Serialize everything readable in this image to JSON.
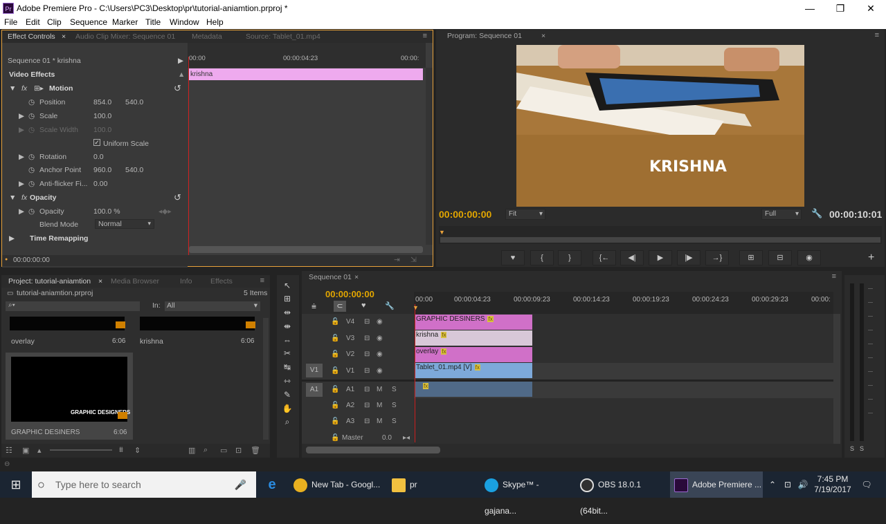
{
  "window": {
    "app_icon": "Pr",
    "title": "Adobe Premiere Pro - C:\\Users\\PC3\\Desktop\\pr\\tutorial-aniamtion.prproj *",
    "minimize": "—",
    "restore": "❐",
    "close": "✕"
  },
  "menu": [
    "File",
    "Edit",
    "Clip",
    "Sequence",
    "Marker",
    "Title",
    "Window",
    "Help"
  ],
  "effect_panel": {
    "tabs": [
      "Effect Controls",
      "Audio Clip Mixer: Sequence 01",
      "Metadata",
      "Source: Tablet_01.mp4"
    ],
    "tab_close": "×",
    "sequence_label": "Sequence 01 * krishna",
    "video_effects": "Video Effects",
    "ruler": {
      "t0": "00:00",
      "t1": "00:00:04:23",
      "t2": "00:00:"
    },
    "clip_bar": "krishna",
    "motion": "Motion",
    "position": {
      "label": "Position",
      "x": "854.0",
      "y": "540.0"
    },
    "scale": {
      "label": "Scale",
      "value": "100.0"
    },
    "scale_width": {
      "label": "Scale Width",
      "value": "100.0"
    },
    "uniform_scale": "Uniform Scale",
    "rotation": {
      "label": "Rotation",
      "value": "0.0"
    },
    "anchor": {
      "label": "Anchor Point",
      "x": "960.0",
      "y": "540.0"
    },
    "antiflicker": {
      "label": "Anti-flicker Fi...",
      "value": "0.00"
    },
    "opacity_group": "Opacity",
    "opacity": {
      "label": "Opacity",
      "value": "100.0 %"
    },
    "blend": {
      "label": "Blend Mode",
      "value": "Normal"
    },
    "time_remap": "Time Remapping",
    "timecode": "00:00:00:00"
  },
  "program": {
    "tab": "Program: Sequence 01",
    "tab_close": "×",
    "overlay_text": "KRISHNA",
    "timecode_left": "00:00:00:00",
    "fit": "Fit",
    "quality": "Full",
    "timecode_right": "00:00:10:01",
    "transport": [
      "♥",
      "{",
      "}",
      "{←",
      "◀|",
      "▶",
      "|▶",
      "→}",
      "⊞",
      "⊟",
      "◉"
    ],
    "add": "+"
  },
  "project": {
    "tabs": [
      "Project: tutorial-aniamtion",
      "Media Browser",
      "Info",
      "Effects"
    ],
    "tab_close": "×",
    "file": "tutorial-aniamtion.prproj",
    "items_count": "5 Items",
    "in_label": "In:",
    "in_value": "All",
    "items": [
      {
        "name": "overlay",
        "duration": "6:06"
      },
      {
        "name": "krishna",
        "duration": "6:06"
      },
      {
        "name": "GRAPHIC DESINERS",
        "duration": "6:06",
        "thumb_text": "GRAPHIC DESIGNERS"
      }
    ]
  },
  "timeline": {
    "tab": "Sequence 01",
    "tab_close": "×",
    "timecode": "00:00:00:00",
    "ruler": [
      "00:00",
      "00:00:04:23",
      "00:00:09:23",
      "00:00:14:23",
      "00:00:19:23",
      "00:00:24:23",
      "00:00:29:23",
      "00:00:"
    ],
    "video_tracks": [
      "V4",
      "V3",
      "V2",
      "V1"
    ],
    "audio_tracks": [
      "A1",
      "A2",
      "A3"
    ],
    "source_v": "V1",
    "source_a": "A1",
    "master": "Master",
    "master_value": "0.0",
    "clips": {
      "v4": "GRAPHIC DESINERS",
      "v3": "krishna",
      "v2": "overlay",
      "v1": "Tablet_01.mp4 [V]"
    },
    "fx": "fx",
    "m": "M",
    "s": "S",
    "meter_labels": [
      "S",
      "S"
    ]
  },
  "taskbar": {
    "search": "Type here to search",
    "apps": [
      {
        "label": "New Tab - Googl...",
        "color": "#e8b020"
      },
      {
        "label": "pr",
        "color": "#f0c040"
      },
      {
        "label": "Skype™ - gajana...",
        "color": "#1aa0e0"
      },
      {
        "label": "OBS 18.0.1 (64bit...",
        "color": "#303030"
      },
      {
        "label": "Adobe Premiere ...",
        "color": "#2a0a3a"
      }
    ],
    "time": "7:45 PM",
    "date": "7/19/2017"
  },
  "colors": {
    "accent": "#e9a23b",
    "clip_pink": "#d070c8",
    "clip_light_pink": "#e8a8e8",
    "clip_blue": "#7da9da",
    "playhead": "#d02020"
  }
}
